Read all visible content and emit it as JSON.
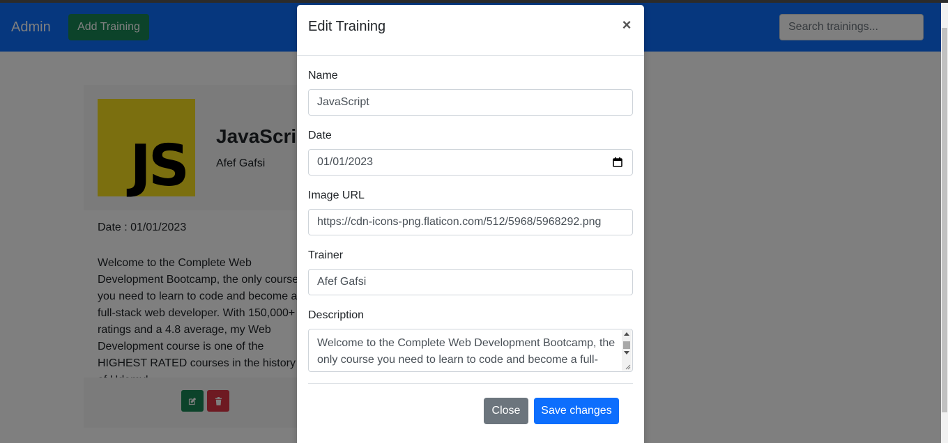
{
  "navbar": {
    "brand": "Admin",
    "add_button_label": "Add Training",
    "search_placeholder": "Search trainings..."
  },
  "card": {
    "title": "JavaScript",
    "trainer": "Afef Gafsi",
    "logo_text": "JS",
    "date_text": "Date : 01/01/2023",
    "description": "Welcome to the Complete Web Development Bootcamp, the only course you need to learn to code and become a full-stack web developer. With 150,000+ ratings and a 4.8 average, my Web Development course is one of the HIGHEST RATED courses in the history of Udemy!",
    "edit_icon": "pencil-square-icon",
    "delete_icon": "trash-icon"
  },
  "modal": {
    "title": "Edit Training",
    "close_symbol": "×",
    "fields": {
      "name_label": "Name",
      "name_value": "JavaScript",
      "date_label": "Date",
      "date_value": "01/01/2023",
      "image_label": "Image URL",
      "image_value": "https://cdn-icons-png.flaticon.com/512/5968/5968292.png",
      "trainer_label": "Trainer",
      "trainer_value": "Afef Gafsi",
      "description_label": "Description",
      "description_value": "Welcome to the Complete Web Development Bootcamp, the only course you need to learn to code and become a full-stack web developer."
    },
    "close_button_label": "Close",
    "save_button_label": "Save changes"
  },
  "colors": {
    "navbar": "#0d6efd",
    "success": "#198754",
    "danger": "#dc3545",
    "secondary": "#6c757d",
    "js_yellow": "#f7df1e"
  }
}
